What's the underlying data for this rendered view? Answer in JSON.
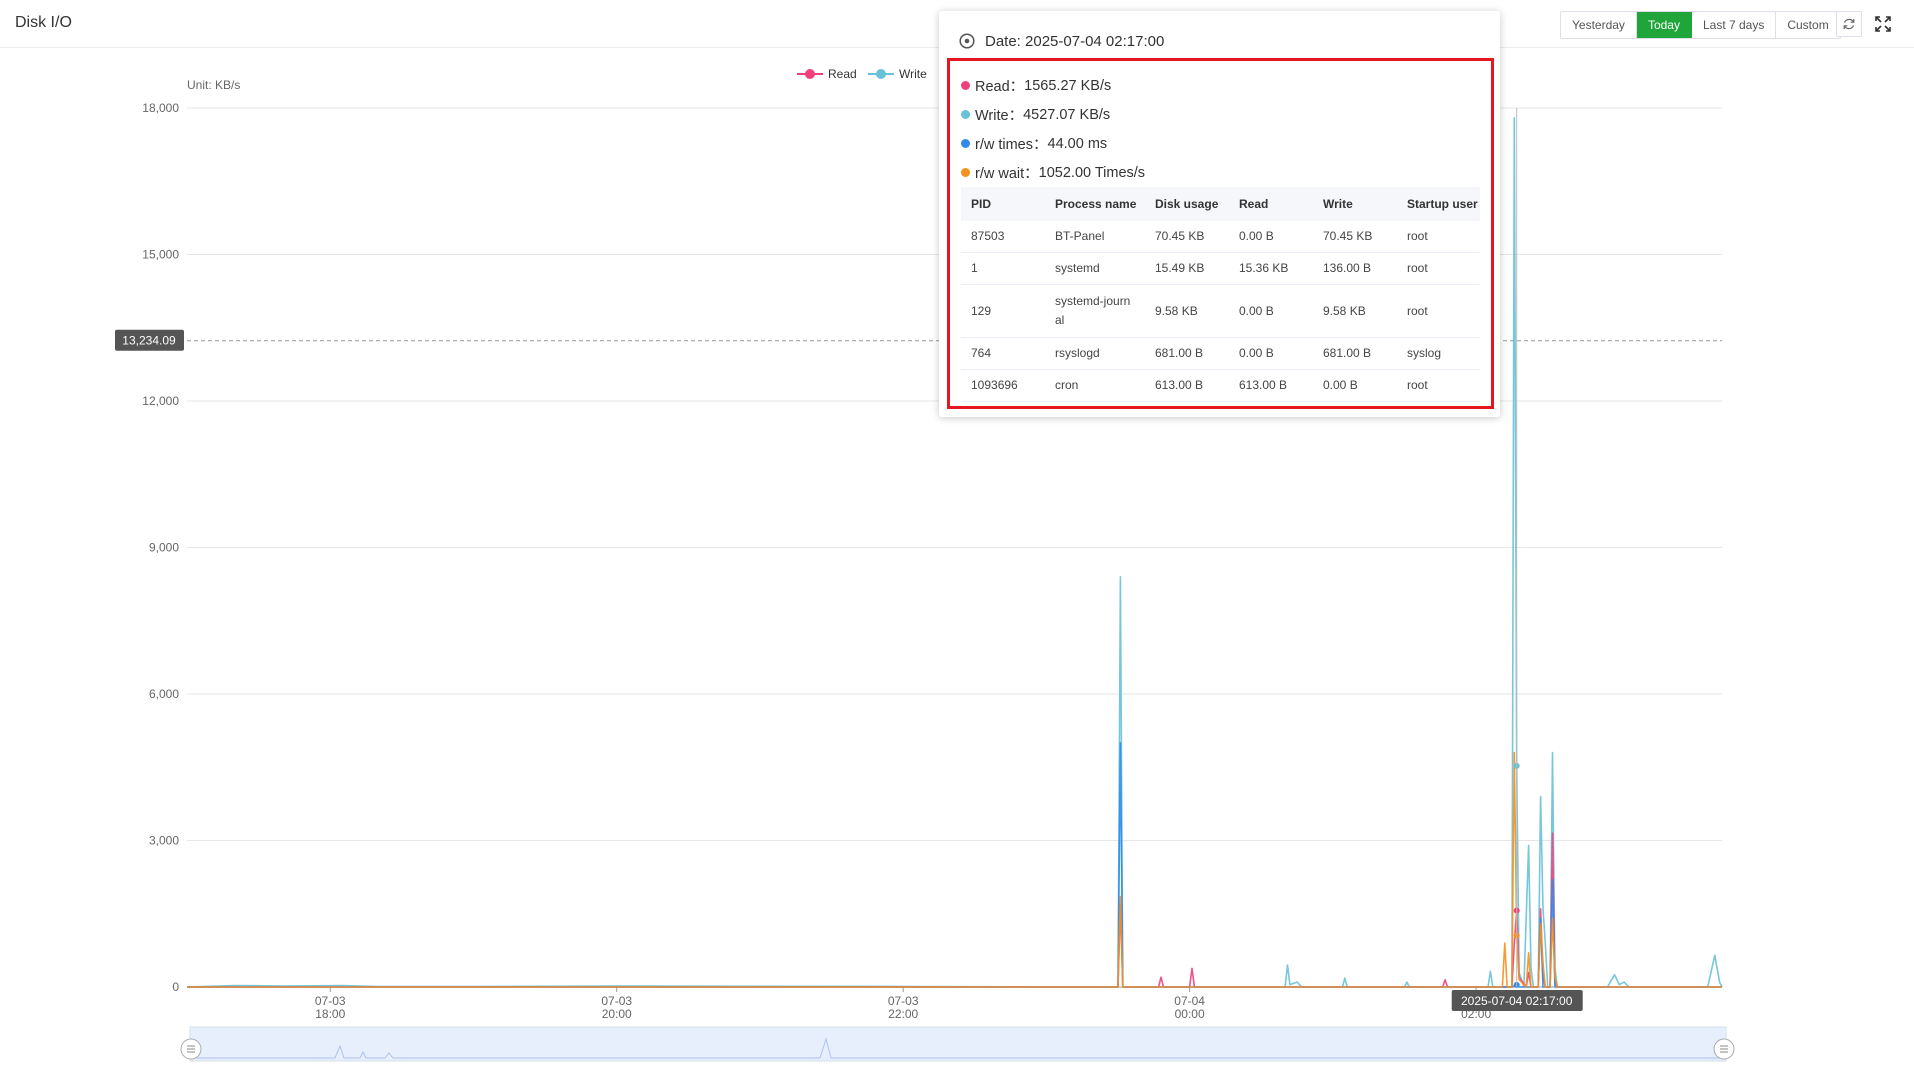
{
  "page": {
    "title": "Disk I/O"
  },
  "toolbar": {
    "ranges": [
      "Yesterday",
      "Today",
      "Last 7 days",
      "Custom"
    ],
    "active_range": "Today",
    "refresh_icon": "refresh-icon",
    "fullscreen_icon": "fullscreen-icon"
  },
  "chart": {
    "unit_label": "Unit: KB/s",
    "pointer_value_label": "13,234.09",
    "pointer_time_label": "2025-07-04 02:17:00"
  },
  "tooltip": {
    "date_icon": "clock-icon",
    "date": "Date: 2025-07-04 02:17:00",
    "metrics": [
      {
        "label": "Read：",
        "value": "1565.27 KB/s",
        "color": "#f0407a"
      },
      {
        "label": "Write：",
        "value": "4527.07 KB/s",
        "color": "#67c1d8"
      },
      {
        "label": "r/w times：",
        "value": "44.00 ms",
        "color": "#2f89e9"
      },
      {
        "label": "r/w wait：",
        "value": "1052.00 Times/s",
        "color": "#f5901e"
      }
    ],
    "table": {
      "headers": [
        "PID",
        "Process name",
        "Disk usage",
        "Read",
        "Write",
        "Startup user"
      ],
      "rows": [
        [
          "87503",
          "BT-Panel",
          "70.45 KB",
          "0.00 B",
          "70.45 KB",
          "root"
        ],
        [
          "1",
          "systemd",
          "15.49 KB",
          "15.36 KB",
          "136.00 B",
          "root"
        ],
        [
          "129",
          "systemd-journal",
          "9.58 KB",
          "0.00 B",
          "9.58 KB",
          "root"
        ],
        [
          "764",
          "rsyslogd",
          "681.00 B",
          "0.00 B",
          "681.00 B",
          "syslog"
        ],
        [
          "1093696",
          "cron",
          "613.00 B",
          "613.00 B",
          "0.00 B",
          "root"
        ]
      ]
    }
  },
  "chart_data": {
    "type": "line",
    "unit": "Unit: KB/s",
    "ylim": [
      0,
      18000
    ],
    "yticks": [
      "0",
      "3,000",
      "6,000",
      "9,000",
      "12,000",
      "15,000",
      "18,000"
    ],
    "xticks": [
      {
        "date": "07-03",
        "time": "18:00"
      },
      {
        "date": "07-03",
        "time": "20:00"
      },
      {
        "date": "07-03",
        "time": "22:00"
      },
      {
        "date": "07-04",
        "time": "00:00"
      },
      {
        "date": "07-04",
        "time": "02:00"
      }
    ],
    "x_start": "2025-07-03 17:00:00",
    "x_end": "2025-07-04 03:43:00",
    "grid": true,
    "legend_position": "top-center",
    "series": [
      {
        "name": "Read",
        "color": "#f0407a",
        "points": [
          [
            "2025-07-03 17:00",
            0
          ],
          [
            "2025-07-03 23:30",
            0
          ],
          [
            "2025-07-03 23:31",
            1700
          ],
          [
            "2025-07-03 23:32",
            0
          ],
          [
            "2025-07-03 23:47",
            0
          ],
          [
            "2025-07-03 23:48",
            200
          ],
          [
            "2025-07-03 23:49",
            0
          ],
          [
            "2025-07-04 00:00",
            0
          ],
          [
            "2025-07-04 00:01",
            380
          ],
          [
            "2025-07-04 00:02",
            0
          ],
          [
            "2025-07-04 01:46",
            0
          ],
          [
            "2025-07-04 01:47",
            150
          ],
          [
            "2025-07-04 01:48",
            0
          ],
          [
            "2025-07-04 02:15",
            0
          ],
          [
            "2025-07-04 02:16",
            900
          ],
          [
            "2025-07-04 02:17",
            1565.27
          ],
          [
            "2025-07-04 02:18",
            200
          ],
          [
            "2025-07-04 02:21",
            0
          ],
          [
            "2025-07-04 02:22",
            300
          ],
          [
            "2025-07-04 02:23",
            0
          ],
          [
            "2025-07-04 02:26",
            0
          ],
          [
            "2025-07-04 02:27",
            1600
          ],
          [
            "2025-07-04 02:28",
            200
          ],
          [
            "2025-07-04 02:29",
            0
          ],
          [
            "2025-07-04 02:31",
            0
          ],
          [
            "2025-07-04 02:32",
            3150
          ],
          [
            "2025-07-04 02:33",
            100
          ],
          [
            "2025-07-04 02:34",
            0
          ],
          [
            "2025-07-04 03:43",
            0
          ]
        ]
      },
      {
        "name": "Write",
        "color": "#67c1d8",
        "points": [
          [
            "2025-07-03 17:00",
            0
          ],
          [
            "2025-07-03 17:20",
            30
          ],
          [
            "2025-07-03 17:40",
            20
          ],
          [
            "2025-07-03 18:05",
            30
          ],
          [
            "2025-07-03 18:20",
            10
          ],
          [
            "2025-07-03 19:00",
            10
          ],
          [
            "2025-07-03 20:00",
            20
          ],
          [
            "2025-07-03 22:00",
            10
          ],
          [
            "2025-07-03 23:30",
            0
          ],
          [
            "2025-07-03 23:31",
            8400
          ],
          [
            "2025-07-03 23:32",
            0
          ],
          [
            "2025-07-04 00:40",
            0
          ],
          [
            "2025-07-04 00:41",
            450
          ],
          [
            "2025-07-04 00:42",
            50
          ],
          [
            "2025-07-04 00:45",
            100
          ],
          [
            "2025-07-04 00:47",
            0
          ],
          [
            "2025-07-04 01:04",
            0
          ],
          [
            "2025-07-04 01:05",
            180
          ],
          [
            "2025-07-04 01:06",
            0
          ],
          [
            "2025-07-04 01:30",
            0
          ],
          [
            "2025-07-04 01:31",
            100
          ],
          [
            "2025-07-04 01:32",
            0
          ],
          [
            "2025-07-04 02:05",
            0
          ],
          [
            "2025-07-04 02:06",
            320
          ],
          [
            "2025-07-04 02:07",
            0
          ],
          [
            "2025-07-04 02:15",
            0
          ],
          [
            "2025-07-04 02:16",
            17800
          ],
          [
            "2025-07-04 02:17",
            4527.07
          ],
          [
            "2025-07-04 02:18",
            300
          ],
          [
            "2025-07-04 02:20",
            0
          ],
          [
            "2025-07-04 02:22",
            2900
          ],
          [
            "2025-07-04 02:23",
            400
          ],
          [
            "2025-07-04 02:24",
            0
          ],
          [
            "2025-07-04 02:26",
            0
          ],
          [
            "2025-07-04 02:27",
            3900
          ],
          [
            "2025-07-04 02:28",
            1600
          ],
          [
            "2025-07-04 02:29",
            900
          ],
          [
            "2025-07-04 02:30",
            0
          ],
          [
            "2025-07-04 02:31",
            0
          ],
          [
            "2025-07-04 02:32",
            4800
          ],
          [
            "2025-07-04 02:33",
            400
          ],
          [
            "2025-07-04 02:34",
            0
          ],
          [
            "2025-07-04 02:55",
            0
          ],
          [
            "2025-07-04 02:58",
            250
          ],
          [
            "2025-07-04 03:00",
            50
          ],
          [
            "2025-07-04 03:02",
            100
          ],
          [
            "2025-07-04 03:04",
            0
          ],
          [
            "2025-07-04 03:20",
            0
          ],
          [
            "2025-07-04 03:37",
            0
          ],
          [
            "2025-07-04 03:40",
            650
          ],
          [
            "2025-07-04 03:42",
            100
          ],
          [
            "2025-07-04 03:43",
            0
          ]
        ]
      },
      {
        "name": "r/w times",
        "color": "#2f89e9",
        "points": [
          [
            "2025-07-03 17:00",
            0
          ],
          [
            "2025-07-03 23:30",
            0
          ],
          [
            "2025-07-03 23:31",
            5000
          ],
          [
            "2025-07-03 23:32",
            0
          ],
          [
            "2025-07-04 02:15",
            0
          ],
          [
            "2025-07-04 02:17",
            44
          ],
          [
            "2025-07-04 02:18",
            0
          ],
          [
            "2025-07-04 02:26",
            0
          ],
          [
            "2025-07-04 02:27",
            1400
          ],
          [
            "2025-07-04 02:28",
            0
          ],
          [
            "2025-07-04 02:31",
            0
          ],
          [
            "2025-07-04 02:32",
            2200
          ],
          [
            "2025-07-04 02:33",
            0
          ],
          [
            "2025-07-04 03:43",
            0
          ]
        ]
      },
      {
        "name": "r/w wait",
        "color": "#f5901e",
        "points": [
          [
            "2025-07-03 17:00",
            0
          ],
          [
            "2025-07-03 23:30",
            0
          ],
          [
            "2025-07-03 23:31",
            1850
          ],
          [
            "2025-07-03 23:32",
            0
          ],
          [
            "2025-07-04 02:11",
            0
          ],
          [
            "2025-07-04 02:12",
            900
          ],
          [
            "2025-07-04 02:13",
            0
          ],
          [
            "2025-07-04 02:15",
            0
          ],
          [
            "2025-07-04 02:16",
            4800
          ],
          [
            "2025-07-04 02:17",
            1052
          ],
          [
            "2025-07-04 02:18",
            150
          ],
          [
            "2025-07-04 02:21",
            0
          ],
          [
            "2025-07-04 02:22",
            700
          ],
          [
            "2025-07-04 02:23",
            0
          ],
          [
            "2025-07-04 02:26",
            0
          ],
          [
            "2025-07-04 02:27",
            1300
          ],
          [
            "2025-07-04 02:28",
            500
          ],
          [
            "2025-07-04 02:29",
            0
          ],
          [
            "2025-07-04 02:31",
            0
          ],
          [
            "2025-07-04 02:32",
            1400
          ],
          [
            "2025-07-04 02:33",
            200
          ],
          [
            "2025-07-04 02:34",
            0
          ],
          [
            "2025-07-04 03:43",
            0
          ]
        ]
      }
    ]
  }
}
